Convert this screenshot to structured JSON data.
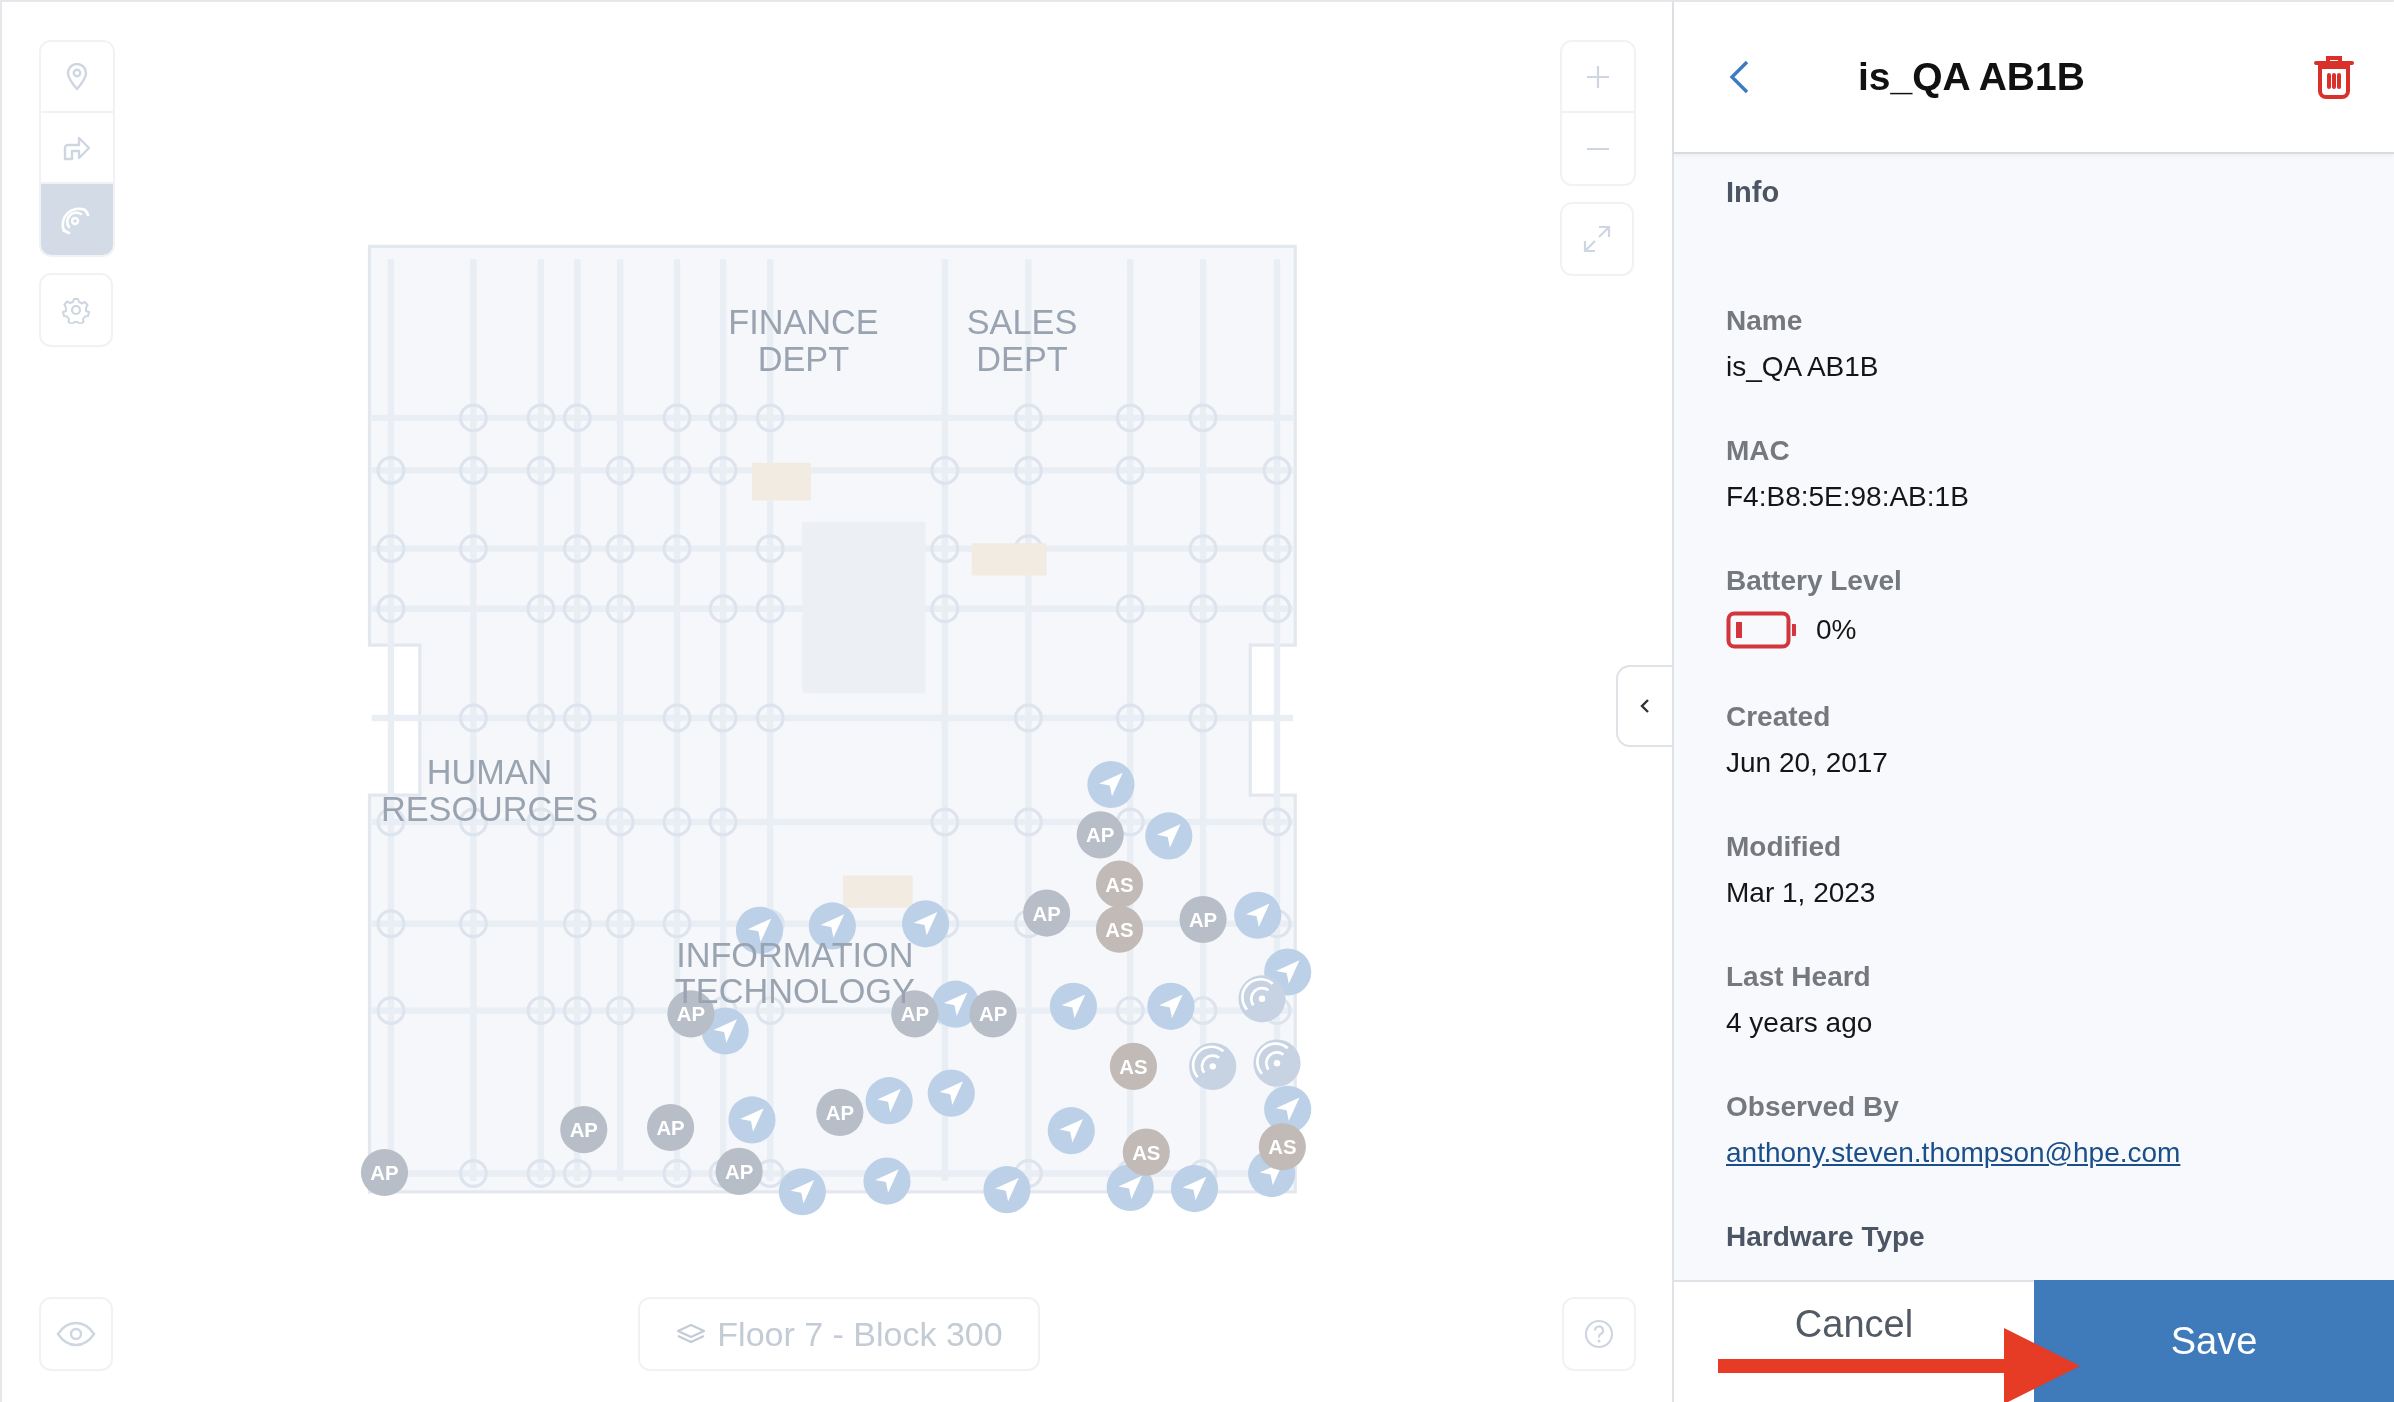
{
  "map": {
    "tools": [
      {
        "kind": "pin",
        "selected": false
      },
      {
        "kind": "route",
        "selected": false
      },
      {
        "kind": "signal",
        "selected": true
      }
    ],
    "area_labels": [
      {
        "lines": [
          "FINANCE",
          "DEPT"
        ]
      },
      {
        "lines": [
          "SALES",
          "DEPT"
        ]
      },
      {
        "lines": [
          "HUMAN",
          "RESOURCES"
        ]
      },
      {
        "lines": [
          "INFORMATION",
          "TECHNOLOGY"
        ]
      }
    ],
    "markers": [
      {
        "kind": "nav"
      },
      {
        "kind": "nav"
      },
      {
        "kind": "nav"
      },
      {
        "kind": "nav"
      },
      {
        "kind": "nav"
      },
      {
        "kind": "nav"
      },
      {
        "kind": "nav"
      },
      {
        "kind": "nav"
      },
      {
        "kind": "nav"
      },
      {
        "kind": "nav"
      },
      {
        "kind": "nav"
      },
      {
        "kind": "nav"
      },
      {
        "kind": "nav"
      },
      {
        "kind": "nav"
      },
      {
        "kind": "nav"
      },
      {
        "kind": "nav"
      },
      {
        "kind": "nav"
      },
      {
        "kind": "nav"
      },
      {
        "kind": "nav"
      },
      {
        "kind": "nav"
      },
      {
        "kind": "nav"
      },
      {
        "kind": "nav"
      },
      {
        "kind": "ap",
        "label": "AP"
      },
      {
        "kind": "ap",
        "label": "AP"
      },
      {
        "kind": "ap",
        "label": "AP"
      },
      {
        "kind": "ap",
        "label": "AP"
      },
      {
        "kind": "ap",
        "label": "AP"
      },
      {
        "kind": "ap",
        "label": "AP"
      },
      {
        "kind": "ap",
        "label": "AP"
      },
      {
        "kind": "ap",
        "label": "AP"
      },
      {
        "kind": "ap",
        "label": "AP"
      },
      {
        "kind": "ap",
        "label": "AP"
      },
      {
        "kind": "ap",
        "label": "AP"
      },
      {
        "kind": "as",
        "label": "AS"
      },
      {
        "kind": "as",
        "label": "AS"
      },
      {
        "kind": "as",
        "label": "AS"
      },
      {
        "kind": "as",
        "label": "AS"
      },
      {
        "kind": "as",
        "label": "AS"
      },
      {
        "kind": "sensor"
      },
      {
        "kind": "sensor"
      },
      {
        "kind": "sensor"
      }
    ],
    "floor_label": "Floor 7 - Block 300"
  },
  "panel": {
    "title": "is_QA AB1B",
    "section": "Info",
    "fields": [
      {
        "kind": "text",
        "label": "Name",
        "value": "is_QA AB1B"
      },
      {
        "kind": "text",
        "label": "MAC",
        "value": "F4:B8:5E:98:AB:1B"
      },
      {
        "kind": "battery",
        "label": "Battery Level",
        "value": "0%"
      },
      {
        "kind": "text",
        "label": "Created",
        "value": "Jun 20, 2017"
      },
      {
        "kind": "text",
        "label": "Modified",
        "value": "Mar 1, 2023"
      },
      {
        "kind": "text",
        "label": "Last Heard",
        "value": "4 years ago"
      },
      {
        "kind": "link",
        "label": "Observed By",
        "value": "anthony.steven.thompson@hpe.com"
      },
      {
        "kind": "heading",
        "label": "Hardware Type"
      }
    ],
    "buttons": [
      {
        "kind": "secondary",
        "label": "Cancel"
      },
      {
        "kind": "primary",
        "label": "Save"
      }
    ]
  }
}
